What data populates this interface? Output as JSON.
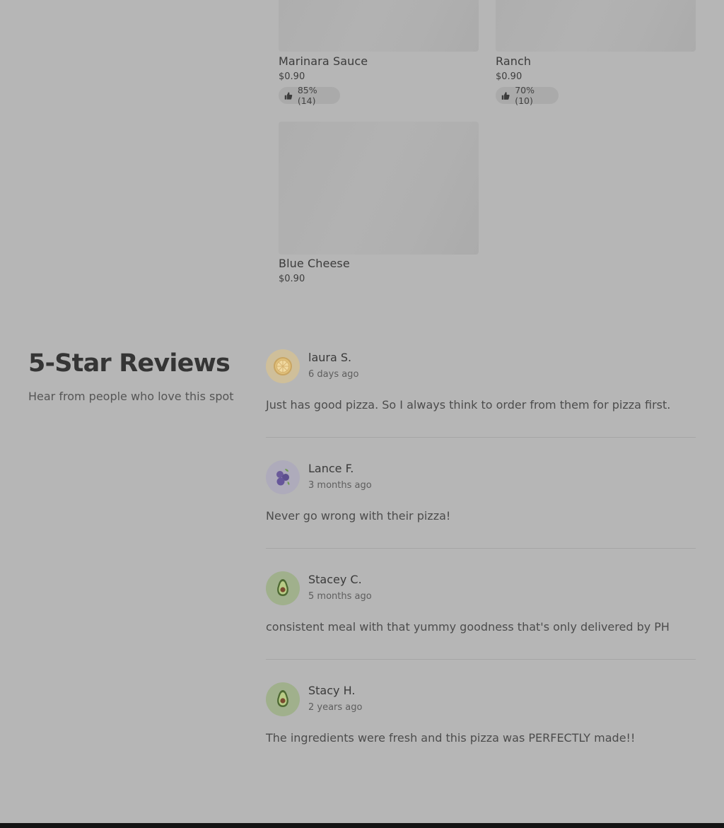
{
  "menu_items": [
    {
      "name": "Marinara Sauce",
      "price": "$0.90",
      "rating": "85% (14)"
    },
    {
      "name": "Ranch",
      "price": "$0.90",
      "rating": "70% (10)"
    },
    {
      "name": "Blue Cheese",
      "price": "$0.90"
    }
  ],
  "reviews_section": {
    "title": "5-Star Reviews",
    "subtitle": "Hear from people who love this spot"
  },
  "reviews": [
    {
      "name": "laura S.",
      "time": "6 days ago",
      "text": "Just has good pizza. So I always think to order from them for pizza first.",
      "avatar_icon": "lemon-icon",
      "avatar_color": "#cfbf9a"
    },
    {
      "name": "Lance F.",
      "time": "3 months ago",
      "text": "Never go wrong with their pizza!",
      "avatar_icon": "blueberry-icon",
      "avatar_color": "#aeabbb"
    },
    {
      "name": "Stacey C.",
      "time": "5 months ago",
      "text": "consistent meal with that yummy goodness that's only delivered by PH",
      "avatar_icon": "avocado-icon",
      "avatar_color": "#a0b08c"
    },
    {
      "name": "Stacy H.",
      "time": "2 years ago",
      "text": "The ingredients were fresh and this pizza was PERFECTLY made!!",
      "avatar_icon": "avocado-icon",
      "avatar_color": "#a0b08c"
    }
  ]
}
